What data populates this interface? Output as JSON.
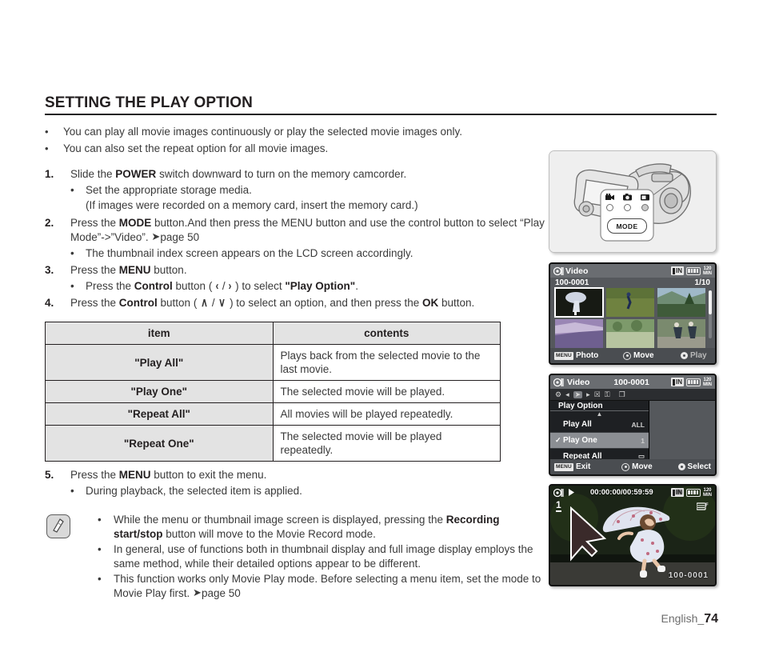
{
  "heading": "SETTING THE PLAY OPTION",
  "intro_bullets": [
    "You can play all movie images continuously or play the selected movie images only.",
    "You can also set the repeat option for all movie images."
  ],
  "steps": {
    "s1_num": "1.",
    "s1_a": "Slide the ",
    "s1_b": "POWER",
    "s1_c": " switch downward to turn on the memory camcorder.",
    "s1_sub1": "Set the appropriate storage media.",
    "s1_sub2": "(If images were recorded on a memory card, insert the memory card.)",
    "s2_num": "2.",
    "s2_a": "Press the ",
    "s2_b": "MODE",
    "s2_c": " button.And then press the MENU button and use the control button to select “Play Mode”->”Video”. ",
    "s2_pageref": "page 50",
    "s2_sub1": "The thumbnail index screen appears on the LCD screen accordingly.",
    "s3_num": "3.",
    "s3_a": "Press the ",
    "s3_b": "MENU",
    "s3_c": " button.",
    "s3_sub_a": "Press the ",
    "s3_sub_b": "Control",
    "s3_sub_c": " button ( ",
    "s3_sub_left": "‹",
    "s3_sub_slash": " / ",
    "s3_sub_right": "›",
    "s3_sub_d": " ) to select ",
    "s3_sub_e": "\"Play Option\"",
    "s3_sub_f": ".",
    "s4_num": "4.",
    "s4_a": "Press the ",
    "s4_b": "Control",
    "s4_c": " button ( ",
    "s4_up": "∧",
    "s4_slash": " / ",
    "s4_down": "∨",
    "s4_d": " ) to select an option, and then press the ",
    "s4_e": "OK",
    "s4_f": " button.",
    "s5_num": "5.",
    "s5_a": "Press the ",
    "s5_b": "MENU",
    "s5_c": " button to exit the menu.",
    "s5_sub1": "During playback, the selected item is applied."
  },
  "table": {
    "header_item": "item",
    "header_contents": "contents",
    "rows": [
      {
        "item": "\"Play All\"",
        "contents": "Plays back from the selected movie to the last movie."
      },
      {
        "item": "\"Play One\"",
        "contents": "The selected movie will be played."
      },
      {
        "item": "\"Repeat All\"",
        "contents": "All movies will be played repeatedly."
      },
      {
        "item": "\"Repeat One\"",
        "contents": "The selected movie will be played repeatedly."
      }
    ]
  },
  "note": {
    "b1_a": "While the menu or thumbnail image screen is displayed, pressing the ",
    "b1_b": "Recording start/stop",
    "b1_c": " button will move to the Movie Record mode.",
    "b2": "In general, use of functions both in thumbnail display and full image display employs the same method, while their detailed options appear to be different.",
    "b3_a": "This function works only Movie Play mode. Before selecting a menu item, set the mode to Movie Play first. ",
    "b3_pageref": "page 50"
  },
  "footer": {
    "language": "English_",
    "page": "74"
  },
  "illustration": {
    "mode_button_label": "MODE",
    "icon_movie": "movie-camera-icon",
    "icon_photo": "camera-icon",
    "icon_play": "play-screen-icon"
  },
  "lcd_thumbnail": {
    "title": "Video",
    "mode_icon": "video-mode-icon",
    "folder": "100-0001",
    "counter": "1/10",
    "status_in": "IN",
    "status_battery": "battery-icon",
    "status_minutes": "120",
    "status_minutes_unit": "MIN",
    "bottom_menu_chip": "MENU",
    "bottom_menu_label": "Photo",
    "bottom_move_label": "Move",
    "bottom_play_label": "Play"
  },
  "lcd_menu": {
    "title": "Video",
    "mode_icon": "video-mode-icon",
    "folder": "100-0001",
    "status_in": "IN",
    "status_battery": "battery-icon",
    "status_minutes": "120",
    "status_minutes_unit": "MIN",
    "tabs": [
      {
        "name": "settings-gear-icon",
        "glyph": "⚙",
        "active": false
      },
      {
        "name": "prev-arrow-icon",
        "glyph": "◂",
        "active": false
      },
      {
        "name": "play-option-icon",
        "glyph": "➤",
        "active": true
      },
      {
        "name": "next-arrow-icon",
        "glyph": "▸",
        "active": false
      },
      {
        "name": "delete-trash-icon",
        "glyph": "☒",
        "active": false
      },
      {
        "name": "protect-lock-icon",
        "glyph": "⚿",
        "active": false
      },
      {
        "name": "copy-files-icon",
        "glyph": "❐",
        "active": false
      }
    ],
    "list_title": "Play Option",
    "items": [
      {
        "label": "Play All",
        "right_icon": "ALL",
        "selected": false,
        "checked": false
      },
      {
        "label": "Play One",
        "right_icon": "1",
        "selected": true,
        "checked": true
      },
      {
        "label": "Repeat All",
        "right_icon": "▭",
        "selected": false,
        "checked": false
      }
    ],
    "bottom_menu_chip": "MENU",
    "bottom_exit_label": "Exit",
    "bottom_move_label": "Move",
    "bottom_select_label": "Select"
  },
  "lcd_play": {
    "mode_icon": "video-mode-icon",
    "play_icon": "play-triangle-icon",
    "timecode": "00:00:00/00:59:59",
    "status_in": "IN",
    "status_battery": "battery-icon",
    "status_minutes": "120",
    "status_minutes_unit": "MIN",
    "play_option_icon": "repeat-one-icon",
    "clip_number": "1",
    "file_name": "100-0001",
    "cursor": "mouse-cursor"
  }
}
